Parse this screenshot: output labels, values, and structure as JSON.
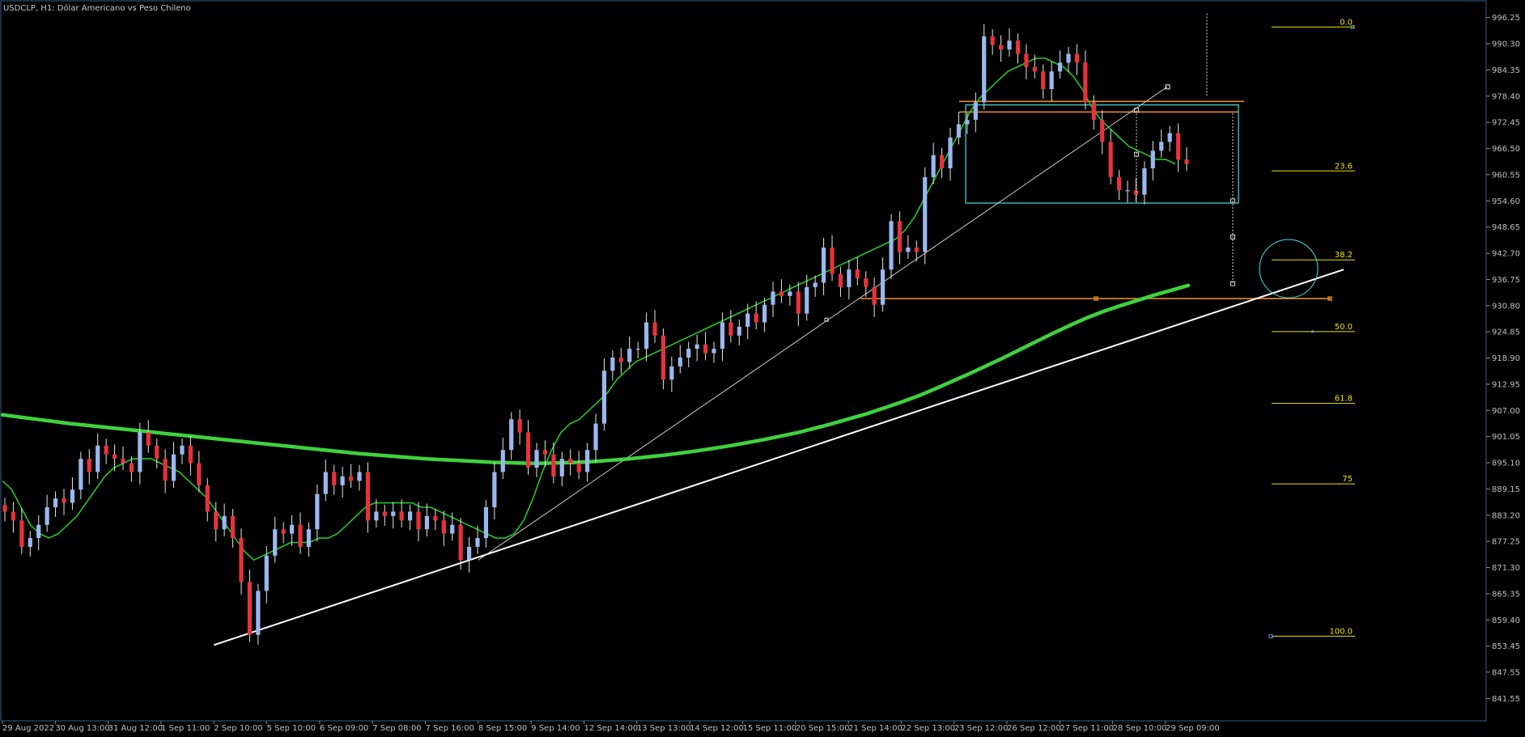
{
  "header": {
    "title": "USDCLP, H1:  Dólar Americano vs Peso Chileno"
  },
  "colors": {
    "background": "#000000",
    "frame": "#3a5a8a",
    "bull_candle": "#9ab8f0",
    "bear_candle": "#e8323c",
    "ma_fast": "#22c822",
    "ma_slow": "#3ed23e",
    "trendline": "#ffffff",
    "support": "#e58a2e",
    "box": "#40e0e0",
    "fib": "#e6e600"
  },
  "chart_data": {
    "type": "candlestick",
    "symbol": "USDCLP",
    "timeframe": "H1",
    "ylim": [
      838.5,
      999.5
    ],
    "y_ticks": [
      "996.25",
      "990.30",
      "984.35",
      "978.40",
      "972.45",
      "966.50",
      "960.55",
      "954.60",
      "948.65",
      "942.70",
      "936.75",
      "930.80",
      "924.85",
      "918.90",
      "912.95",
      "907.00",
      "901.05",
      "895.10",
      "889.15",
      "883.20",
      "877.25",
      "871.30",
      "865.35",
      "859.40",
      "853.45",
      "847.55",
      "841.55"
    ],
    "x_ticks": [
      "29 Aug 2022",
      "30 Aug 13:00",
      "31 Aug 12:00",
      "1 Sep 11:00",
      "2 Sep 10:00",
      "5 Sep 10:00",
      "6 Sep 09:00",
      "7 Sep 08:00",
      "7 Sep 16:00",
      "8 Sep 15:00",
      "9 Sep 14:00",
      "12 Sep 14:00",
      "13 Sep 13:00",
      "14 Sep 12:00",
      "15 Sep 11:00",
      "20 Sep 15:00",
      "21 Sep 14:00",
      "22 Sep 13:00",
      "23 Sep 12:00",
      "26 Sep 12:00",
      "27 Sep 11:00",
      "28 Sep 10:00",
      "29 Sep 09:00"
    ],
    "candle_closes": [
      884,
      882,
      876,
      878,
      881,
      885,
      887,
      886,
      889,
      896,
      893,
      899,
      897,
      896,
      895,
      893,
      902,
      899,
      896,
      891,
      897,
      899,
      895,
      890,
      884,
      880,
      883,
      878,
      868,
      856,
      866,
      874,
      880,
      879,
      881,
      876,
      880,
      888,
      893,
      890,
      892,
      891,
      893,
      882,
      884,
      883,
      884,
      882,
      884,
      880,
      883,
      882,
      879,
      881,
      873,
      876,
      878,
      885,
      893,
      898,
      905,
      902,
      894,
      898,
      897,
      892,
      896,
      895,
      893,
      898,
      904,
      916,
      919,
      918,
      921,
      921,
      927,
      924,
      914,
      917,
      919,
      921,
      922,
      920,
      921,
      927,
      924,
      926,
      929,
      927,
      931,
      934,
      933,
      934,
      929,
      935,
      936,
      944,
      938,
      935,
      939,
      937,
      935,
      931,
      939,
      950,
      943,
      944,
      943,
      960,
      965,
      962,
      969,
      972,
      973,
      977,
      992,
      990,
      989,
      991,
      988,
      985,
      984,
      980,
      984,
      986,
      988,
      986,
      977,
      973,
      968,
      960,
      957,
      957,
      956,
      962,
      966,
      968,
      970,
      964,
      963
    ],
    "ma_fast": [
      891,
      889,
      885,
      881,
      879,
      878,
      879,
      881,
      883,
      886,
      889,
      892,
      894,
      895,
      896,
      896,
      896,
      895,
      894,
      893,
      891,
      889,
      887,
      884,
      881,
      878,
      875,
      873,
      874,
      875,
      876,
      877,
      877,
      877,
      878,
      878,
      879,
      881,
      883,
      885,
      886,
      886,
      886,
      886,
      886,
      885,
      885,
      884,
      883,
      882,
      881,
      880,
      879,
      878,
      878,
      879,
      882,
      887,
      893,
      898,
      902,
      904,
      905,
      907,
      909,
      911,
      914,
      916,
      918,
      919,
      920,
      921,
      922,
      923,
      924,
      925,
      926,
      927,
      928,
      929,
      930,
      931,
      932,
      933,
      934,
      935,
      936,
      937,
      938,
      939,
      940,
      941,
      942,
      943,
      944,
      945,
      946,
      948,
      951,
      955,
      959,
      963,
      967,
      971,
      975,
      978,
      980,
      982,
      984,
      985,
      986,
      987,
      987,
      986,
      985,
      983,
      980,
      976,
      973,
      971,
      969,
      967,
      966,
      965,
      964,
      964,
      963
    ],
    "ma_slow": [
      906,
      905.5,
      905,
      904.5,
      904,
      903.6,
      903.2,
      902.8,
      902.4,
      902,
      901.6,
      901.2,
      900.8,
      900.4,
      900,
      899.6,
      899.2,
      898.8,
      898.4,
      898,
      897.6,
      897.2,
      896.9,
      896.6,
      896.3,
      896,
      895.8,
      895.6,
      895.4,
      895.2,
      895.1,
      895,
      895,
      895.1,
      895.2,
      895.4,
      895.7,
      896,
      896.4,
      896.8,
      897.3,
      897.8,
      898.4,
      899,
      899.7,
      900.4,
      901.2,
      902,
      903,
      904,
      905.1,
      906.2,
      907.5,
      908.8,
      910.2,
      911.8,
      913.5,
      915.2,
      917,
      918.8,
      920.7,
      922.6,
      924.5,
      926.3,
      928,
      929.5,
      930.8,
      932,
      933.2,
      934.3,
      935.4
    ],
    "trendlines": [
      {
        "from": {
          "x": "2 Sep 10:00",
          "y": 853.7
        },
        "to": {
          "x": "29 Sep 09:00",
          "y": 939.0
        }
      },
      {
        "from": {
          "x": "8 Sep 15:00",
          "y": 873.0
        },
        "to": {
          "x": "28 Sep 10:00",
          "y": 980.5
        }
      }
    ],
    "horizontal_levels": [
      {
        "name": "support",
        "y": 932.4
      },
      {
        "name": "resistance-upper",
        "y": 977.2
      },
      {
        "name": "resistance-lower",
        "y": 974.8
      }
    ],
    "consolidation_box": {
      "y_top": 976.4,
      "y_bottom": 954.1
    },
    "fibonacci": {
      "levels": [
        {
          "label": "0.0",
          "price": 994.1
        },
        {
          "label": "23.6",
          "price": 961.4
        },
        {
          "label": "38.2",
          "price": 941.2
        },
        {
          "label": "50.0",
          "price": 924.9
        },
        {
          "label": "61.8",
          "price": 908.6
        },
        {
          "label": "75",
          "price": 890.3
        },
        {
          "label": "100.0",
          "price": 855.7
        }
      ]
    }
  }
}
